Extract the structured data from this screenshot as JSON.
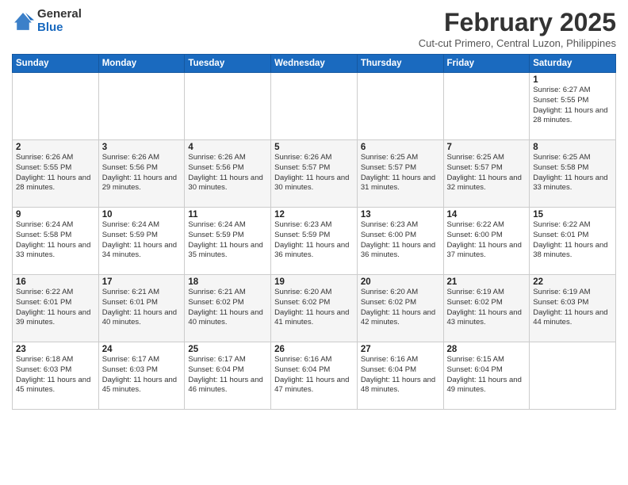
{
  "logo": {
    "general": "General",
    "blue": "Blue"
  },
  "header": {
    "month": "February 2025",
    "location": "Cut-cut Primero, Central Luzon, Philippines"
  },
  "weekdays": [
    "Sunday",
    "Monday",
    "Tuesday",
    "Wednesday",
    "Thursday",
    "Friday",
    "Saturday"
  ],
  "weeks": [
    [
      {
        "day": "",
        "info": ""
      },
      {
        "day": "",
        "info": ""
      },
      {
        "day": "",
        "info": ""
      },
      {
        "day": "",
        "info": ""
      },
      {
        "day": "",
        "info": ""
      },
      {
        "day": "",
        "info": ""
      },
      {
        "day": "1",
        "info": "Sunrise: 6:27 AM\nSunset: 5:55 PM\nDaylight: 11 hours and 28 minutes."
      }
    ],
    [
      {
        "day": "2",
        "info": "Sunrise: 6:26 AM\nSunset: 5:55 PM\nDaylight: 11 hours and 28 minutes."
      },
      {
        "day": "3",
        "info": "Sunrise: 6:26 AM\nSunset: 5:56 PM\nDaylight: 11 hours and 29 minutes."
      },
      {
        "day": "4",
        "info": "Sunrise: 6:26 AM\nSunset: 5:56 PM\nDaylight: 11 hours and 30 minutes."
      },
      {
        "day": "5",
        "info": "Sunrise: 6:26 AM\nSunset: 5:57 PM\nDaylight: 11 hours and 30 minutes."
      },
      {
        "day": "6",
        "info": "Sunrise: 6:25 AM\nSunset: 5:57 PM\nDaylight: 11 hours and 31 minutes."
      },
      {
        "day": "7",
        "info": "Sunrise: 6:25 AM\nSunset: 5:57 PM\nDaylight: 11 hours and 32 minutes."
      },
      {
        "day": "8",
        "info": "Sunrise: 6:25 AM\nSunset: 5:58 PM\nDaylight: 11 hours and 33 minutes."
      }
    ],
    [
      {
        "day": "9",
        "info": "Sunrise: 6:24 AM\nSunset: 5:58 PM\nDaylight: 11 hours and 33 minutes."
      },
      {
        "day": "10",
        "info": "Sunrise: 6:24 AM\nSunset: 5:59 PM\nDaylight: 11 hours and 34 minutes."
      },
      {
        "day": "11",
        "info": "Sunrise: 6:24 AM\nSunset: 5:59 PM\nDaylight: 11 hours and 35 minutes."
      },
      {
        "day": "12",
        "info": "Sunrise: 6:23 AM\nSunset: 5:59 PM\nDaylight: 11 hours and 36 minutes."
      },
      {
        "day": "13",
        "info": "Sunrise: 6:23 AM\nSunset: 6:00 PM\nDaylight: 11 hours and 36 minutes."
      },
      {
        "day": "14",
        "info": "Sunrise: 6:22 AM\nSunset: 6:00 PM\nDaylight: 11 hours and 37 minutes."
      },
      {
        "day": "15",
        "info": "Sunrise: 6:22 AM\nSunset: 6:01 PM\nDaylight: 11 hours and 38 minutes."
      }
    ],
    [
      {
        "day": "16",
        "info": "Sunrise: 6:22 AM\nSunset: 6:01 PM\nDaylight: 11 hours and 39 minutes."
      },
      {
        "day": "17",
        "info": "Sunrise: 6:21 AM\nSunset: 6:01 PM\nDaylight: 11 hours and 40 minutes."
      },
      {
        "day": "18",
        "info": "Sunrise: 6:21 AM\nSunset: 6:02 PM\nDaylight: 11 hours and 40 minutes."
      },
      {
        "day": "19",
        "info": "Sunrise: 6:20 AM\nSunset: 6:02 PM\nDaylight: 11 hours and 41 minutes."
      },
      {
        "day": "20",
        "info": "Sunrise: 6:20 AM\nSunset: 6:02 PM\nDaylight: 11 hours and 42 minutes."
      },
      {
        "day": "21",
        "info": "Sunrise: 6:19 AM\nSunset: 6:02 PM\nDaylight: 11 hours and 43 minutes."
      },
      {
        "day": "22",
        "info": "Sunrise: 6:19 AM\nSunset: 6:03 PM\nDaylight: 11 hours and 44 minutes."
      }
    ],
    [
      {
        "day": "23",
        "info": "Sunrise: 6:18 AM\nSunset: 6:03 PM\nDaylight: 11 hours and 45 minutes."
      },
      {
        "day": "24",
        "info": "Sunrise: 6:17 AM\nSunset: 6:03 PM\nDaylight: 11 hours and 45 minutes."
      },
      {
        "day": "25",
        "info": "Sunrise: 6:17 AM\nSunset: 6:04 PM\nDaylight: 11 hours and 46 minutes."
      },
      {
        "day": "26",
        "info": "Sunrise: 6:16 AM\nSunset: 6:04 PM\nDaylight: 11 hours and 47 minutes."
      },
      {
        "day": "27",
        "info": "Sunrise: 6:16 AM\nSunset: 6:04 PM\nDaylight: 11 hours and 48 minutes."
      },
      {
        "day": "28",
        "info": "Sunrise: 6:15 AM\nSunset: 6:04 PM\nDaylight: 11 hours and 49 minutes."
      },
      {
        "day": "",
        "info": ""
      }
    ]
  ]
}
